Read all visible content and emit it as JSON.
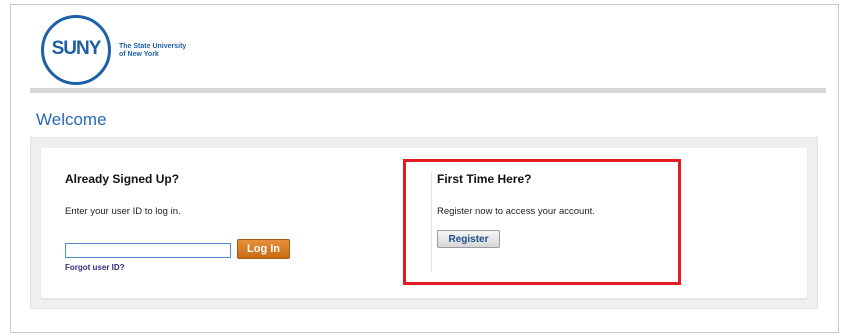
{
  "brand": {
    "logo_mark": "SUNY",
    "logo_text_line1": "The State University",
    "logo_text_line2": "of New York",
    "colors": {
      "brand_blue": "#1f5fa8",
      "accent_orange": "#d87a22",
      "highlight_red": "#e31b23"
    }
  },
  "page": {
    "title": "Welcome"
  },
  "login": {
    "heading": "Already Signed Up?",
    "description": "Enter your user ID to log in.",
    "userid_value": "",
    "login_label": "Log In",
    "forgot_label": "Forgot user ID?"
  },
  "register": {
    "heading": "First Time Here?",
    "description": "Register now to access your account.",
    "register_label": "Register"
  }
}
